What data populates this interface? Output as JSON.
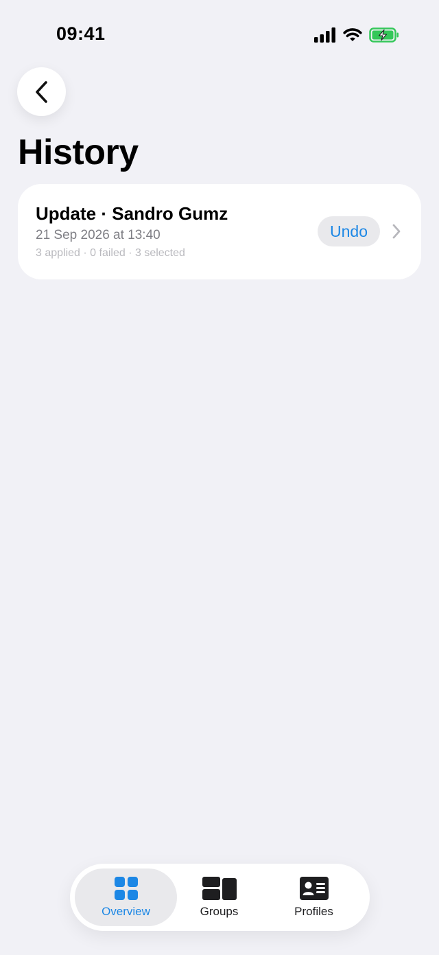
{
  "status_bar": {
    "time": "09:41"
  },
  "header": {
    "title": "History"
  },
  "history": [
    {
      "title": "Update · Sandro Gumz",
      "date": "21 Sep 2026 at 13:40",
      "meta": "3 applied · 0 failed · 3 selected",
      "action_label": "Undo"
    }
  ],
  "tab_bar": {
    "tabs": [
      {
        "label": "Overview",
        "icon": "grid-icon",
        "active": true
      },
      {
        "label": "Groups",
        "icon": "groups-icon",
        "active": false
      },
      {
        "label": "Profiles",
        "icon": "profile-card-icon",
        "active": false
      }
    ]
  },
  "colors": {
    "accent": "#1C87E5",
    "battery": "#34C759",
    "background": "#F1F1F6"
  }
}
